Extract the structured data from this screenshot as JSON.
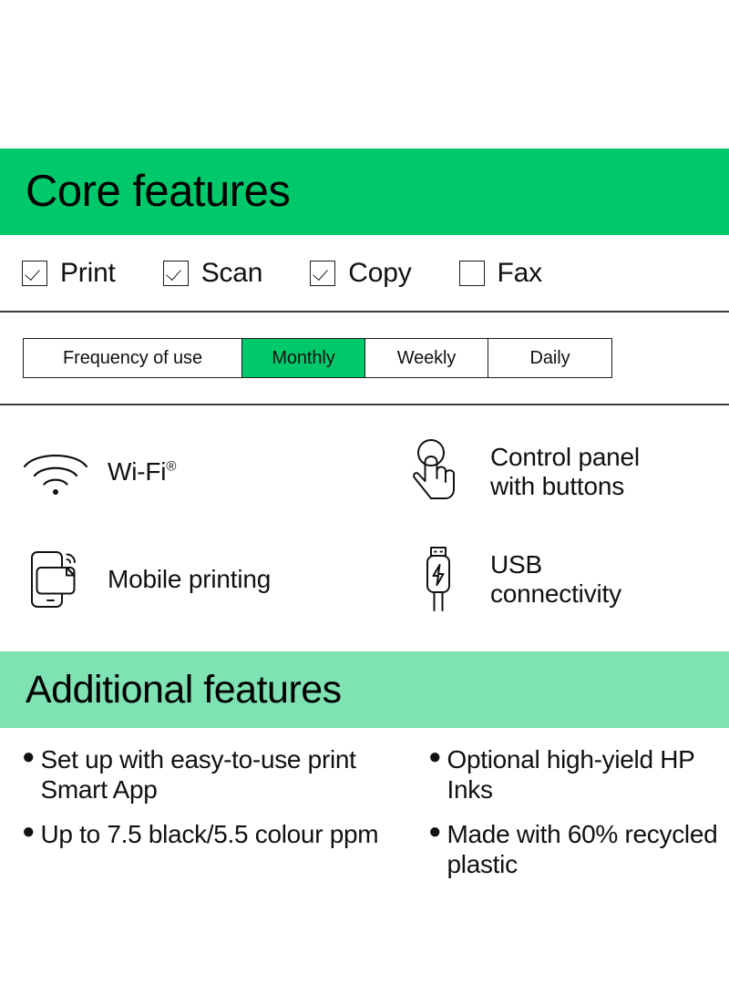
{
  "colors": {
    "primary_green": "#00c96c",
    "light_green": "#7ee2b3",
    "ink": "#111111",
    "divider": "#3d3d3d"
  },
  "core_section": {
    "title": "Core features",
    "capabilities": [
      {
        "label": "Print",
        "checked": true,
        "icon": "checkbox-checked-icon"
      },
      {
        "label": "Scan",
        "checked": true,
        "icon": "checkbox-checked-icon"
      },
      {
        "label": "Copy",
        "checked": true,
        "icon": "checkbox-checked-icon"
      },
      {
        "label": "Fax",
        "checked": false,
        "icon": "checkbox-unchecked-icon"
      }
    ],
    "frequency": {
      "label": "Frequency of use",
      "options": [
        "Monthly",
        "Weekly",
        "Daily"
      ],
      "selected": "Monthly"
    },
    "features": [
      {
        "label": "Wi-Fi",
        "superscript": "®",
        "icon": "wifi-icon"
      },
      {
        "label": "Control panel\nwith buttons",
        "line1": "Control panel",
        "line2": "with buttons",
        "icon": "touch-button-icon"
      },
      {
        "label": "Mobile printing",
        "icon": "mobile-printing-icon"
      },
      {
        "label": "USB connectivity",
        "line1": "USB",
        "line2": "connectivity",
        "icon": "usb-cable-icon"
      }
    ]
  },
  "additional_section": {
    "title": "Additional features",
    "bullets_left": [
      "Set up with easy-to-use print Smart App",
      "Up to 7.5 black/5.5 colour ppm"
    ],
    "bullets_right": [
      "Optional high-yield HP Inks",
      "Made with 60% recycled plastic"
    ],
    "bullet_glyph": "●"
  }
}
